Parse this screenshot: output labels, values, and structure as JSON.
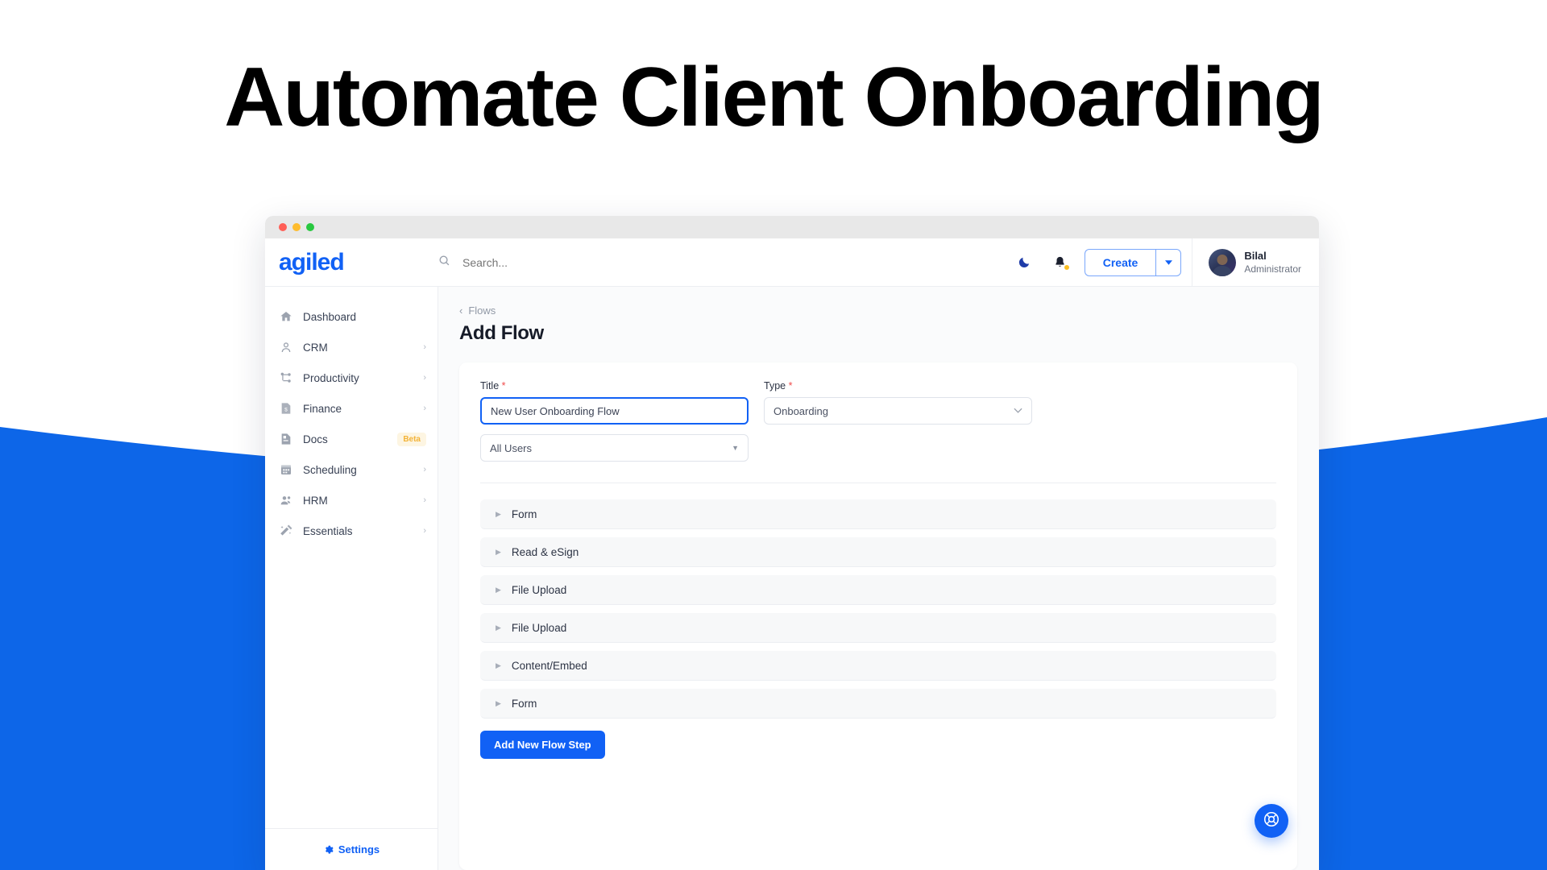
{
  "hero": {
    "headline": "Automate Client Onboarding",
    "accent_color": "#0d66e8",
    "headline_color": "#000000"
  },
  "window": {
    "traffic_lights": [
      "close-red",
      "minimize-amber",
      "maximize-green"
    ]
  },
  "topbar": {
    "brand": "agiled",
    "brand_color": "#1161f5",
    "search": {
      "placeholder": "Search...",
      "value": "",
      "icon": "search-icon"
    },
    "theme_toggle_icon": "moon-icon",
    "notifications_icon": "bell-icon",
    "notification_badge": true,
    "create_label": "Create",
    "create_caret_icon": "caret-down-icon",
    "user": {
      "name": "Bilal",
      "role": "Administrator"
    }
  },
  "sidebar": {
    "items": [
      {
        "label": "Dashboard",
        "icon": "home-icon",
        "caret": false,
        "badge": null
      },
      {
        "label": "CRM",
        "icon": "user-icon",
        "caret": true,
        "badge": null
      },
      {
        "label": "Productivity",
        "icon": "workflow-icon",
        "caret": true,
        "badge": null
      },
      {
        "label": "Finance",
        "icon": "invoice-icon",
        "caret": true,
        "badge": null
      },
      {
        "label": "Docs",
        "icon": "document-icon",
        "caret": false,
        "badge": "Beta"
      },
      {
        "label": "Scheduling",
        "icon": "calendar-icon",
        "caret": true,
        "badge": null
      },
      {
        "label": "HRM",
        "icon": "people-icon",
        "caret": true,
        "badge": null
      },
      {
        "label": "Essentials",
        "icon": "magic-wand-icon",
        "caret": true,
        "badge": null
      }
    ],
    "settings_label": "Settings",
    "settings_icon": "gear-icon",
    "badge_color": "#f3b338"
  },
  "main": {
    "breadcrumb": "Flows",
    "breadcrumb_icon": "chevron-left-icon",
    "page_title": "Add Flow",
    "form": {
      "title_field": {
        "label": "Title",
        "required": true,
        "value": "New User Onboarding Flow",
        "placeholder": "Title",
        "focused": true
      },
      "type_field": {
        "label": "Type",
        "required": true,
        "value": "Onboarding",
        "options": [
          "Onboarding"
        ],
        "caret_icon": "chevron-down-icon"
      },
      "users_field": {
        "label": "",
        "value": "All Users",
        "options": [
          "All Users"
        ],
        "caret_icon": "caret-down-icon"
      }
    },
    "steps": [
      {
        "label": "Form",
        "caret_icon": "caret-right-icon",
        "expanded": false
      },
      {
        "label": "Read & eSign",
        "caret_icon": "caret-right-icon",
        "expanded": false
      },
      {
        "label": "File Upload",
        "caret_icon": "caret-right-icon",
        "expanded": false
      },
      {
        "label": "File Upload",
        "caret_icon": "caret-right-icon",
        "expanded": false
      },
      {
        "label": "Content/Embed",
        "caret_icon": "caret-right-icon",
        "expanded": false
      },
      {
        "label": "Form",
        "caret_icon": "caret-right-icon",
        "expanded": false
      }
    ],
    "add_step_label": "Add New Flow Step",
    "primary_color": "#1161f5"
  },
  "help": {
    "icon": "life-ring-icon",
    "color": "#1161f5"
  }
}
